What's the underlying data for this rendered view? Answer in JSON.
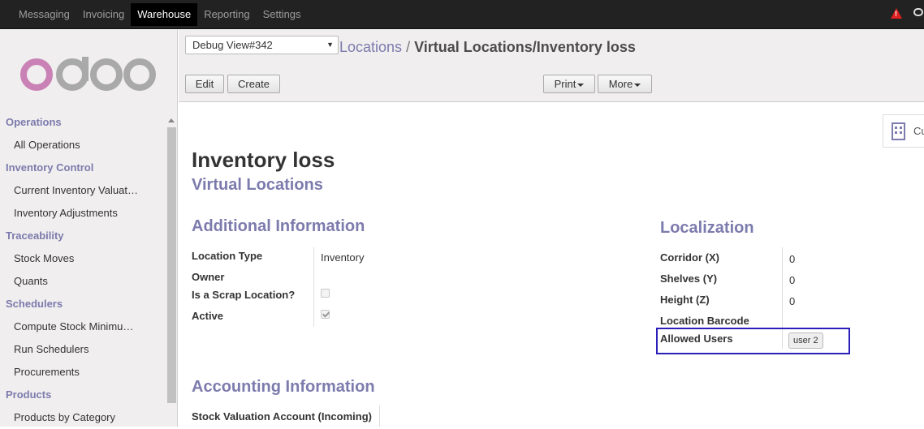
{
  "topnav": {
    "items": [
      "Messaging",
      "Invoicing",
      "Warehouse",
      "Reporting",
      "Settings"
    ],
    "active": "Warehouse"
  },
  "logo": {
    "text": "odoo",
    "colors": {
      "o1": "#c981b6",
      "rest": "#a9a9a9"
    }
  },
  "sidebar": {
    "sections": [
      {
        "title": "Operations",
        "items": [
          "All Operations"
        ]
      },
      {
        "title": "Inventory Control",
        "items": [
          "Current Inventory Valuat…",
          "Inventory Adjustments"
        ]
      },
      {
        "title": "Traceability",
        "items": [
          "Stock Moves",
          "Quants"
        ]
      },
      {
        "title": "Schedulers",
        "items": [
          "Compute Stock Minimu…",
          "Run Schedulers",
          "Procurements"
        ]
      },
      {
        "title": "Products",
        "items": [
          "Products by Category"
        ]
      }
    ]
  },
  "control_panel": {
    "debug_select": "Debug View#342",
    "breadcrumb": {
      "parent": "Locations",
      "separator": "/",
      "current": "Virtual Locations/Inventory loss"
    },
    "buttons": {
      "edit": "Edit",
      "create": "Create",
      "print": "Print",
      "more": "More"
    }
  },
  "form": {
    "smart_button_label": "Cu",
    "name": "Inventory loss",
    "parent": "Virtual Locations",
    "additional": {
      "heading": "Additional Information",
      "location_type_label": "Location Type",
      "location_type_value": "Inventory",
      "owner_label": "Owner",
      "scrap_label": "Is a Scrap Location?",
      "scrap_checked": false,
      "active_label": "Active",
      "active_checked": true
    },
    "localization": {
      "heading": "Localization",
      "corridor_label": "Corridor (X)",
      "corridor_value": "0",
      "shelves_label": "Shelves (Y)",
      "shelves_value": "0",
      "height_label": "Height (Z)",
      "height_value": "0",
      "barcode_label": "Location Barcode",
      "allowed_users_label": "Allowed Users",
      "allowed_users_tag": "user 2"
    },
    "accounting": {
      "heading": "Accounting Information",
      "stock_valuation_in_label": "Stock Valuation Account (Incoming)"
    }
  },
  "colors": {
    "accent": "#7c7bad",
    "highlight": "#2a1fb8",
    "topbar": "#222222"
  }
}
